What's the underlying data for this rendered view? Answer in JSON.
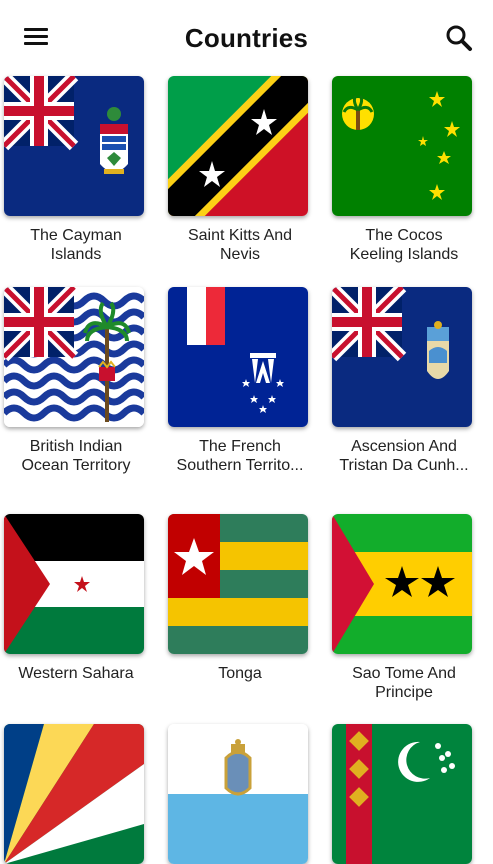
{
  "appbar": {
    "title": "Countries",
    "menu_icon": "hamburger-menu-icon",
    "search_icon": "search-icon"
  },
  "countries": [
    {
      "line1": "The Cayman",
      "line2": "Islands"
    },
    {
      "line1": "Saint Kitts And",
      "line2": "Nevis"
    },
    {
      "line1": "The Cocos",
      "line2": "Keeling Islands"
    },
    {
      "line1": "British Indian",
      "line2": "Ocean Territory"
    },
    {
      "line1": "The French",
      "line2": "Southern Territo..."
    },
    {
      "line1": "Ascension And",
      "line2": "Tristan Da Cunh..."
    },
    {
      "line1": "Western Sahara",
      "line2": ""
    },
    {
      "line1": "Tonga",
      "line2": ""
    },
    {
      "line1": "Sao Tome And",
      "line2": "Principe"
    }
  ],
  "colors": {
    "navy": "#012169",
    "red": "#C8102E",
    "green": "#008000"
  }
}
